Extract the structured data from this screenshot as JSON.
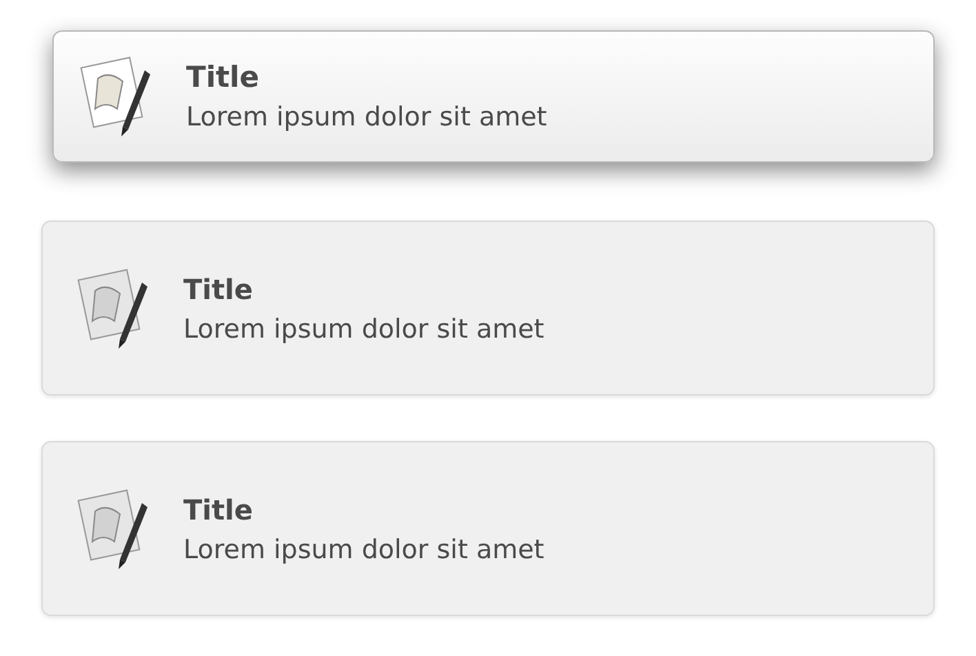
{
  "cards": [
    {
      "title": "Title",
      "subtitle": "Lorem ipsum dolor sit amet",
      "selected": true
    },
    {
      "title": "Title",
      "subtitle": "Lorem ipsum dolor sit amet",
      "selected": false
    },
    {
      "title": "Title",
      "subtitle": "Lorem ipsum dolor sit amet",
      "selected": false
    }
  ]
}
